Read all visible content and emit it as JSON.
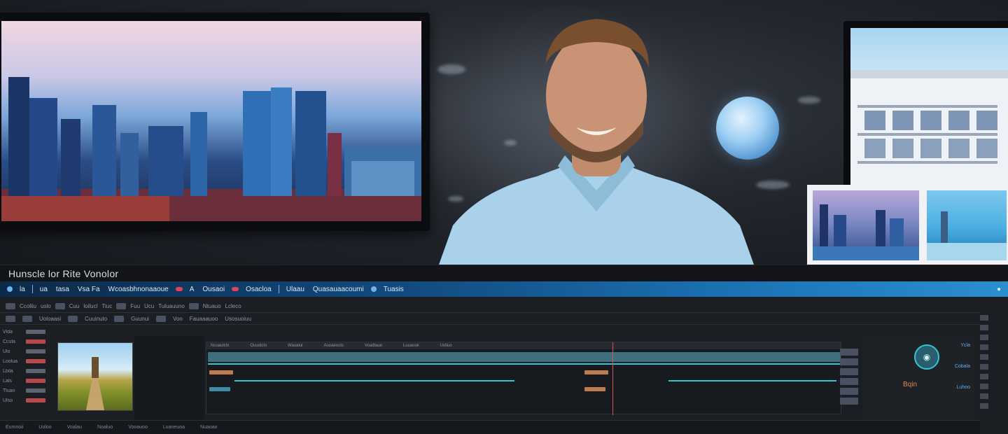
{
  "app": {
    "title": "Hunscle lor Rite  Vonolor"
  },
  "menu": {
    "items": [
      "la",
      "ua",
      "tasa",
      "Vsa  Fa",
      "Wcoasbhnonaaoue",
      "A",
      "Ousaoi",
      "Osacloa",
      "Ulaau",
      "Quasauaacoumi",
      "Tuasis"
    ]
  },
  "toolbar": {
    "row1": [
      "Ccoliiu",
      "uslo",
      "Cuu",
      "loilucl",
      "Tiuc",
      "Fuu",
      "Ucu",
      "Tuluauuno",
      "Ntuauo",
      "Lcleco"
    ],
    "row2": [
      "Uoloaasi",
      "Cuuinuto",
      "Guunui",
      "Voo",
      "Fauaaauoo",
      "Usosuoiuu"
    ]
  },
  "left_panel": {
    "rows": [
      "Vlda",
      "Ccula",
      "Ulo",
      "Loolua",
      "Lbila",
      "Lals",
      "Tluan",
      "Ulso"
    ]
  },
  "timeline": {
    "ruler": [
      "Ncuaulclo",
      "Ouuolclo",
      "Waoalul",
      "Auuaeoclo",
      "Voadlaue",
      "Luuaooii",
      "Uoliuo"
    ]
  },
  "scope": {
    "label": "Bqin",
    "readouts": [
      "Ycla",
      "Cobala",
      "Luhoo"
    ]
  },
  "status_bar": {
    "items": [
      "Eumnoii",
      "Uoloo",
      "Voalau",
      "Noaluo",
      "Vooauoo",
      "Luaneuoa",
      "Nuaoao"
    ]
  },
  "colors": {
    "accent": "#2fc7d3",
    "menu_bar_start": "#0d2a49",
    "menu_bar_end": "#2b8fd0",
    "playhead": "#e05050"
  }
}
